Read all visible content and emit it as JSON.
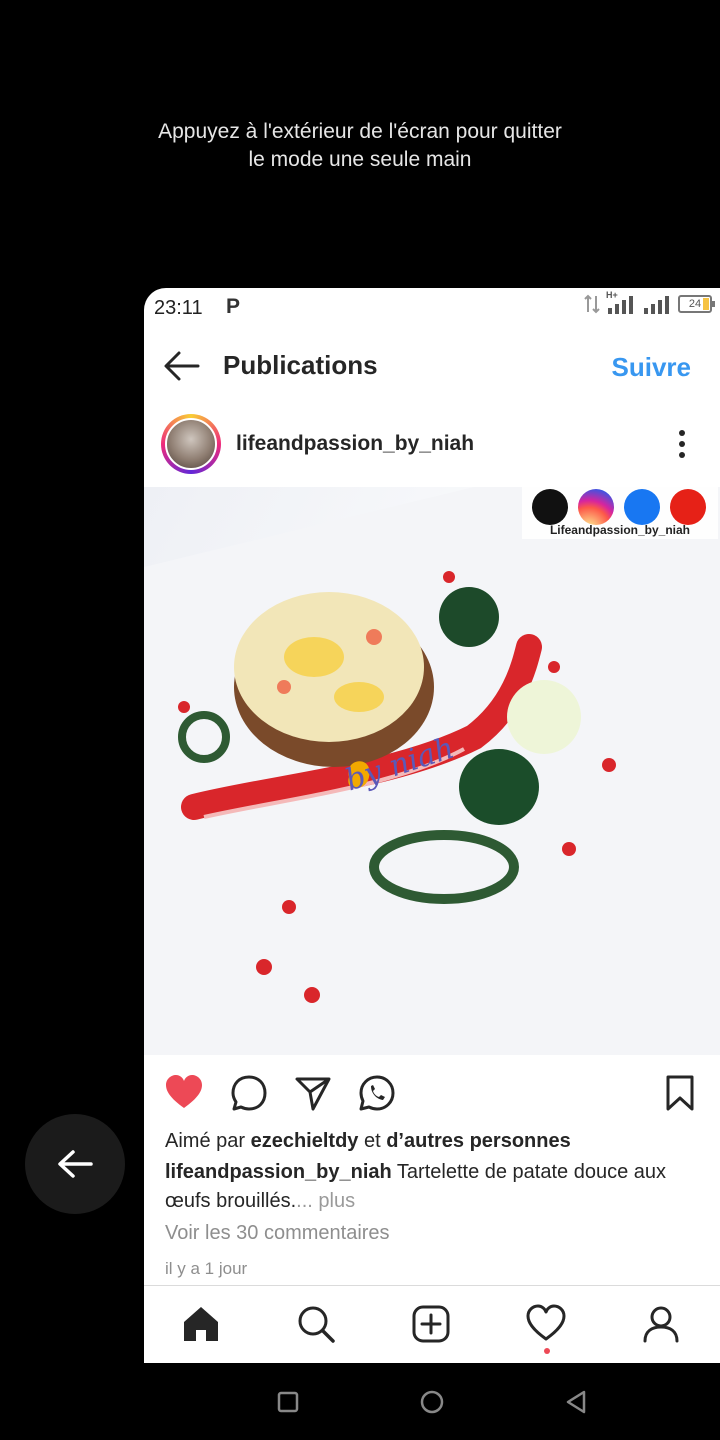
{
  "overlay": {
    "line1": "Appuyez à l'extérieur de l'écran pour quitter",
    "line2": "le mode une seule main"
  },
  "status_bar": {
    "time": "23:11",
    "notif_letter": "P",
    "battery": "24",
    "network_label": "H+"
  },
  "header": {
    "title": "Publications",
    "follow_label": "Suivre"
  },
  "post": {
    "username": "lifeandpassion_by_niah",
    "image": {
      "social_handle": "Lifeandpassion_by_niah",
      "watermark": "by niah"
    },
    "likes": {
      "prefix": "Aimé par ",
      "user": "ezechieltdy",
      "middle": " et ",
      "suffix": "d’autres personnes"
    },
    "caption": {
      "user": "lifeandpassion_by_niah",
      "text": " Tartelette de patate douce aux œufs brouillés.",
      "ellipsis": "...",
      "more": " plus"
    },
    "comments_link": "Voir les 30 commentaires",
    "timestamp": "il y a 1 jour"
  },
  "icons": {
    "like": "heart-filled-icon",
    "comment": "comment-icon",
    "share": "send-icon",
    "whatsapp": "whatsapp-icon",
    "save": "bookmark-icon"
  },
  "colors": {
    "like_red": "#ed4956",
    "follow_blue": "#3897f0",
    "notif_dot": "#ed4956"
  }
}
